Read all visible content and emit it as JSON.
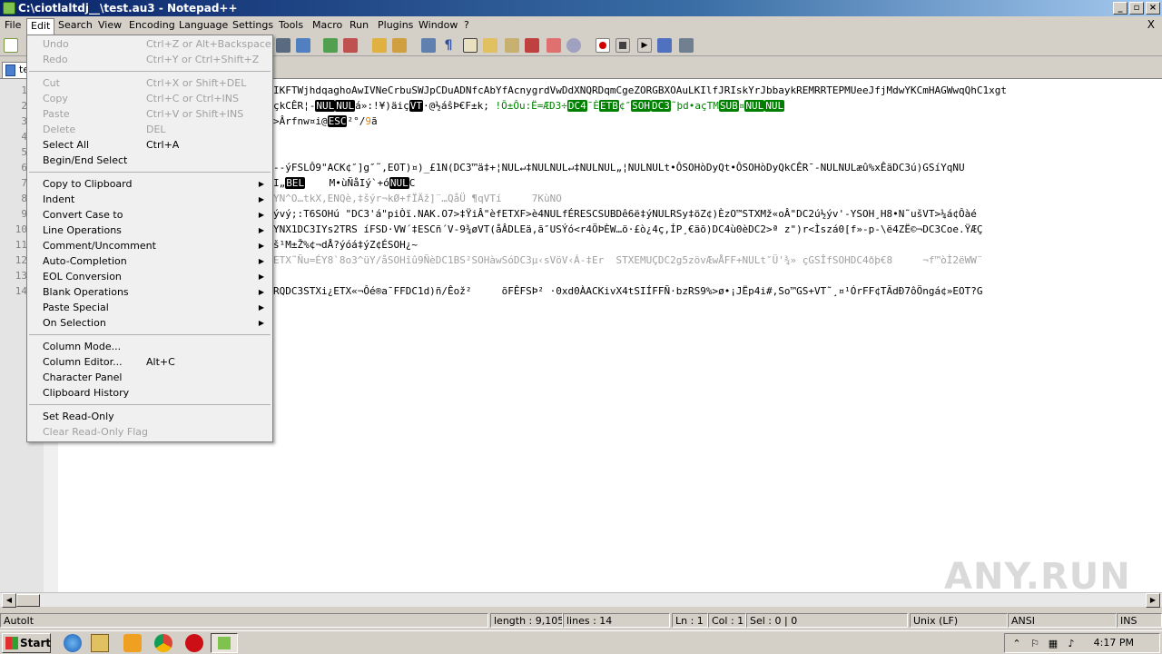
{
  "window": {
    "title": "C:\\ciotlaltdj__\\test.au3 - Notepad++"
  },
  "menubar": [
    "File",
    "Edit",
    "Search",
    "View",
    "Encoding",
    "Language",
    "Settings",
    "Tools",
    "Macro",
    "Run",
    "Plugins",
    "Window",
    "?"
  ],
  "menubar_close": "X",
  "tab": {
    "label": "te"
  },
  "edit_menu": {
    "undo": {
      "label": "Undo",
      "shortcut": "Ctrl+Z or Alt+Backspace"
    },
    "redo": {
      "label": "Redo",
      "shortcut": "Ctrl+Y or Ctrl+Shift+Z"
    },
    "cut": {
      "label": "Cut",
      "shortcut": "Ctrl+X or Shift+DEL"
    },
    "copy": {
      "label": "Copy",
      "shortcut": "Ctrl+C or Ctrl+INS"
    },
    "paste": {
      "label": "Paste",
      "shortcut": "Ctrl+V or Shift+INS"
    },
    "delete": {
      "label": "Delete",
      "shortcut": "DEL"
    },
    "select_all": {
      "label": "Select All",
      "shortcut": "Ctrl+A"
    },
    "begin_end_select": {
      "label": "Begin/End Select"
    },
    "copy_to_clipboard": {
      "label": "Copy to Clipboard"
    },
    "indent": {
      "label": "Indent"
    },
    "convert_case": {
      "label": "Convert Case to"
    },
    "line_operations": {
      "label": "Line Operations"
    },
    "comment": {
      "label": "Comment/Uncomment"
    },
    "auto_completion": {
      "label": "Auto-Completion"
    },
    "eol_conversion": {
      "label": "EOL Conversion"
    },
    "blank_operations": {
      "label": "Blank Operations"
    },
    "paste_special": {
      "label": "Paste Special"
    },
    "on_selection": {
      "label": "On Selection"
    },
    "column_mode": {
      "label": "Column Mode..."
    },
    "column_editor": {
      "label": "Column Editor...",
      "shortcut": "Alt+C"
    },
    "character_panel": {
      "label": "Character Panel"
    },
    "clipboard_history": {
      "label": "Clipboard History"
    },
    "set_read_only": {
      "label": "Set Read-Only"
    },
    "clear_read_only": {
      "label": "Clear Read-Only Flag"
    }
  },
  "gutter_numbers": [
    "1",
    "2",
    "3",
    "4",
    "5",
    "6",
    "7",
    "8",
    "9",
    "10",
    "11",
    "12",
    "13",
    "14"
  ],
  "code": {
    "l1": "IKFTWjhdqaghoAwIVNeCrbuSWJpCDuADNfcAbYfAcnygrdVwDdXNQRDqmCgeZORGBXOAuLKIlfJRIskYrJbbaykREMRRTEPMUeeJfjMdwYKCmHAGWwqQhC1xgt",
    "l2a": "çkCÊR¦-",
    "l2b": "NUL",
    "l2c": "NUL",
    "l2d": "á»:!¥)äiç",
    "l2e": "VT",
    "l2f": "·@½áŝÞ€F±k;",
    "l2g": " !Ô±Ôu:Ë=ÆD3÷",
    "l2h": "DC4",
    "l2i": "¯È",
    "l2j": "ETB",
    "l2k": "¢″",
    "l2l": "SOH",
    "l2m": "DC3",
    "l2n": "˜þd•açTM",
    "l2o": "SUB",
    "l2p": "¤",
    "l2q": "NUL",
    "l2r": "NUL",
    "l3a": ">Ârfnw¤i@",
    "l3b": "ESC",
    "l3c": "²°/",
    "l3d": "9",
    "l3e": "ã",
    "l6": "--ýFSLÔ9\"ACK¢″]g″˜,EOT)¤)_£1N(DC3™ä‡+¦NUL↵‡NULNUL↵‡NULNUL„¦NULNULt•ÔSOHòDyQt•ÔSOHòDyQkCÊR¯-NULNULæû%xÊäDC3ú)GSíYqNU",
    "l7a": "I„",
    "l7b": "BEL",
    "l7c": "    M•ùÑåIý`+ó",
    "l7d": "NUL",
    "l7e": "C",
    "l8": "YN^O…tkX,ENQè,‡šýr¬kØ+fÏÄž]¨…QåÜ ¶qVTí     7KùNO",
    "l9": "ývý;:T6SOHú \"DC3'á\"piÒï.NAK.O7>‡ŸiÂ\"èfETXF>è4NULfÉRESCSUBDê6ë‡ýNULRSy‡öZ¢)ÈzO™STXMž«oÂ\"DC2ú½ýv'-YSOH¸H8•N˜ušVT>¼á¢Ôàé",
    "l10": "YNX1DC3IYs2TRS íFSD·VW´‡ESCñ´V-9¾øVT(åÂDLEä,ã″USÝó<r4ÖÞÈW…ö·£ò¿4ç,ÍP¸€äõ)DC4ù0èDC2>ª z\")r<Ìszá0[f»-p-\\ë4ZË©¬DC3Coe.ŸÆÇ",
    "l11": "š¹M±Ž%¢¬dÅ?ýóá‡ýZ¢ÉSOH¿~",
    "l12": "ETX˜Ñu=ÉY8`8o3^üY/åSOHîû9ÑèDC1BS²SOHàwSóDC3µ‹sVöV‹Á-‡Er  STXEMUÇDC2g5zövÆwÅFF+NULt″Ü'¾» çGSÎfSOHDC4ðþ€8     ¬f™òÌ2ëWW¨",
    "l14": "RQDC3STXi¿ETX«¬Ôé®a¯FFDC1d)ñ/Êož²     õFÊFSÞ² ·0xd0ÀACKivX4tSIÍFFÑ·bzRS9%>ø•¡JËp4i#,So™GS+VT˜¸¤¹ÓrFF¢TÃdÐ7ôÖngá¢»EOT?G"
  },
  "status": {
    "language": "AutoIt",
    "length": "length : 9,105",
    "lines": "lines : 14",
    "ln": "Ln : 1",
    "col": "Col : 1",
    "sel": "Sel : 0 | 0",
    "eol": "Unix (LF)",
    "encoding": "ANSI",
    "mode": "INS"
  },
  "taskbar": {
    "start": "Start",
    "clock": "4:17 PM"
  },
  "watermark": "ANY.RUN",
  "colors": {
    "title_start": "#0a246a",
    "title_end": "#a6caf0",
    "menu_bg": "#f0f0f0",
    "control_char_bg": "#000000",
    "green_ctrl_bg": "#008000"
  }
}
